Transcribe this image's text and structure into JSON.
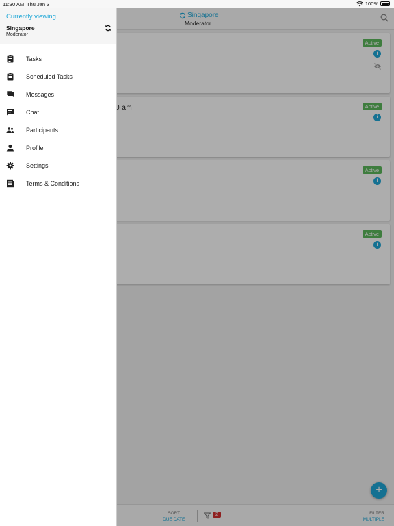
{
  "status_bar": {
    "time": "11:30 AM",
    "date": "Thu Jan 3",
    "battery": "100%"
  },
  "topbar": {
    "location": "Singapore",
    "role": "Moderator"
  },
  "cards": [
    {
      "badge": "Active",
      "title": ""
    },
    {
      "badge": "Active",
      "title": "0 am"
    },
    {
      "badge": "Active",
      "title": ""
    },
    {
      "badge": "Active",
      "title": ""
    }
  ],
  "info_label": "i",
  "bottom_bar": {
    "sort_label": "SORT",
    "sort_value": "DUE DATE",
    "filter_count": "2",
    "filter_label": "FILTER",
    "filter_value": "MULTIPLE"
  },
  "fab_label": "+",
  "drawer": {
    "header": {
      "currently_viewing": "Currently viewing",
      "site": "Singapore",
      "role": "Moderator"
    },
    "items": [
      {
        "label": "Tasks",
        "icon": "clipboard-icon"
      },
      {
        "label": "Scheduled Tasks",
        "icon": "clipboard-icon"
      },
      {
        "label": "Messages",
        "icon": "messages-icon"
      },
      {
        "label": "Chat",
        "icon": "chat-icon"
      },
      {
        "label": "Participants",
        "icon": "participants-icon"
      },
      {
        "label": "Profile",
        "icon": "profile-icon"
      },
      {
        "label": "Settings",
        "icon": "gear-icon"
      },
      {
        "label": "Terms & Conditions",
        "icon": "document-icon"
      }
    ]
  },
  "colors": {
    "accent": "#1ea7d7",
    "active_badge": "#5cb85c",
    "count_badge": "#d32f2f"
  }
}
